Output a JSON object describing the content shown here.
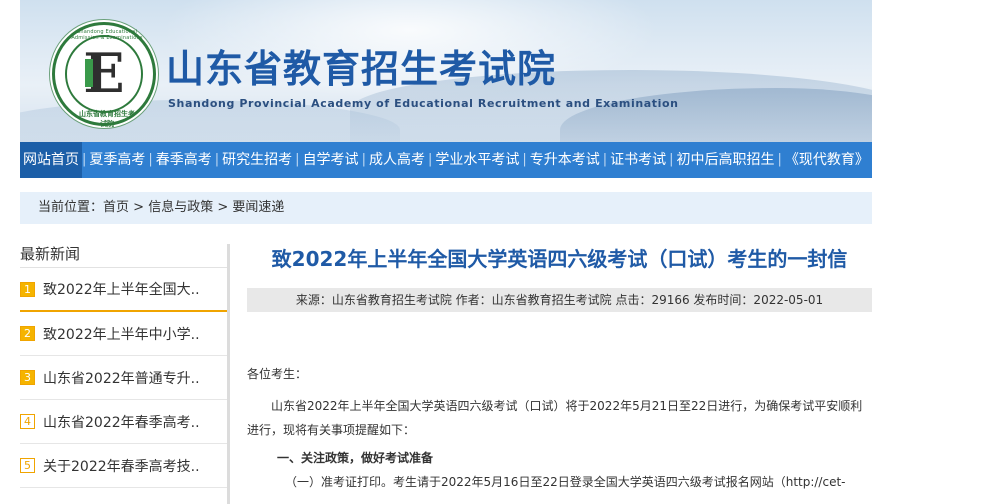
{
  "site": {
    "title_cn": "山东省教育招生考试院",
    "title_en": "Shandong Provincial Academy of Educational Recruitment and Examination",
    "logo_ring_top": "Shandong Educational Admission & Examinations",
    "logo_ring_bottom": "山东省教育招生考试院",
    "logo_letter": "E"
  },
  "nav": {
    "items": [
      "网站首页",
      "夏季高考",
      "春季高考",
      "研究生招考",
      "自学考试",
      "成人高考",
      "学业水平考试",
      "专升本考试",
      "证书考试",
      "初中后高职招生",
      "《现代教育》"
    ],
    "separator": "|"
  },
  "breadcrumb": {
    "prefix": "当前位置：",
    "home": "首页",
    "sep": " > ",
    "level1": "信息与政策",
    "level2": "要闻速递"
  },
  "sidebar": {
    "heading": "最新新闻",
    "items": [
      {
        "num": "1",
        "text": "致2022年上半年全国大.."
      },
      {
        "num": "2",
        "text": "致2022年上半年中小学.."
      },
      {
        "num": "3",
        "text": "山东省2022年普通专升.."
      },
      {
        "num": "4",
        "text": "山东省2022年春季高考.."
      },
      {
        "num": "5",
        "text": "关于2022年春季高考技.."
      }
    ]
  },
  "article": {
    "title": "致2022年上半年全国大学英语四六级考试（口试）考生的一封信",
    "meta": "来源：山东省教育招生考试院 作者：山东省教育招生考试院 点击：29166 发布时间：2022-05-01",
    "greeting": "各位考生：",
    "para1": "山东省2022年上半年全国大学英语四六级考试（口试）将于2022年5月21日至22日进行，为确保考试平安顺利进行，现将有关事项提醒如下：",
    "section1": "一、关注政策，做好考试准备",
    "sub1": "（一）准考证打印。考生请于2022年5月16日至22日登录全国大学英语四六级考试报名网站（http://cet-"
  },
  "colors": {
    "nav_bg": "#2f7fd1",
    "nav_active": "#1c5fa8",
    "brand_blue": "#1f5aa6",
    "accent_orange": "#f5b400",
    "crumb_bg": "#e6f0fa"
  }
}
